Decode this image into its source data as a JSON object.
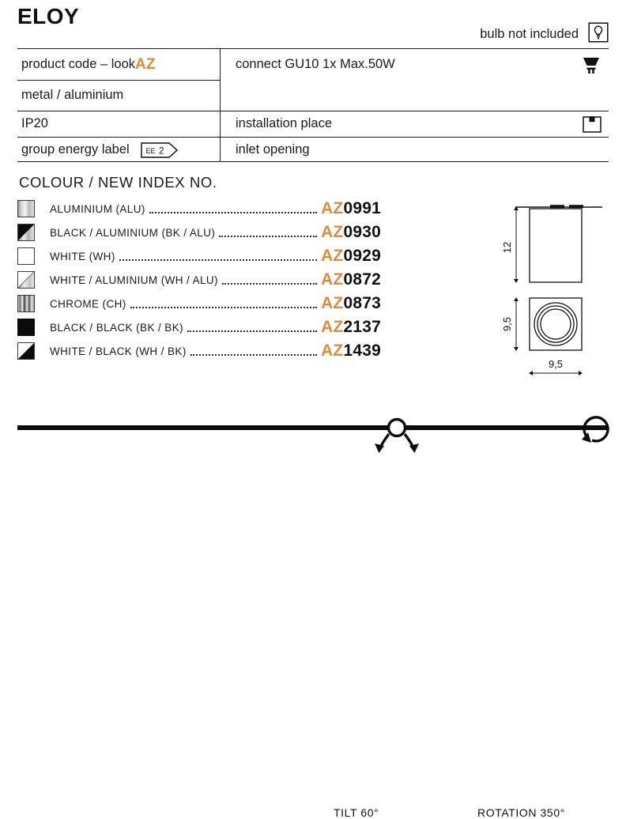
{
  "product": {
    "title": "ELOY"
  },
  "bulb_note": {
    "label": "bulb not included",
    "icon": "bulb-in-box-icon"
  },
  "spec_table": {
    "rows": [
      {
        "left": "product code – look ",
        "left_accent": "AZ",
        "right": "connect GU10 1x Max.50W",
        "right_icon": "gu10-lamp-icon"
      },
      {
        "left": "metal / aluminium",
        "right": "",
        "right_icon": ""
      },
      {
        "left": "IP20",
        "right": "installation place",
        "right_icon": "ceiling-mount-icon"
      },
      {
        "left": "group energy label",
        "left_badge": "EE 2",
        "right": "inlet opening",
        "right_icon": ""
      }
    ]
  },
  "colour_section": {
    "heading": "COLOUR / NEW INDEX NO.",
    "items": [
      {
        "swatch": "aluminium",
        "name": "ALUMINIUM (ALU)",
        "code_prefix": "AZ",
        "code_number": "0991"
      },
      {
        "swatch": "black-aluminium",
        "name": "BLACK / ALUMINIUM (BK / ALU)",
        "code_prefix": "AZ",
        "code_number": "0930"
      },
      {
        "swatch": "white",
        "name": "WHITE (WH)",
        "code_prefix": "AZ",
        "code_number": "0929"
      },
      {
        "swatch": "white-aluminium",
        "name": "WHITE / ALUMINIUM (WH / ALU)",
        "code_prefix": "AZ",
        "code_number": "0872"
      },
      {
        "swatch": "chrome",
        "name": "CHROME (CH)",
        "code_prefix": "AZ",
        "code_number": "0873"
      },
      {
        "swatch": "black-black",
        "name": "BLACK / BLACK (BK / BK)",
        "code_prefix": "AZ",
        "code_number": "2137"
      },
      {
        "swatch": "white-black",
        "name": "WHITE / BLACK (WH / BK)",
        "code_prefix": "AZ",
        "code_number": "1439"
      }
    ]
  },
  "tech_drawing": {
    "height_label": "12",
    "width_label": "9,5",
    "depth_label": "9,5"
  },
  "motion": {
    "tilt_label": "TILT 60°",
    "rotation_label": "ROTATION 350°"
  },
  "colors": {
    "accent": "#e08a3c",
    "ink": "#1a1a1a",
    "rule": "#1a1a1a"
  }
}
